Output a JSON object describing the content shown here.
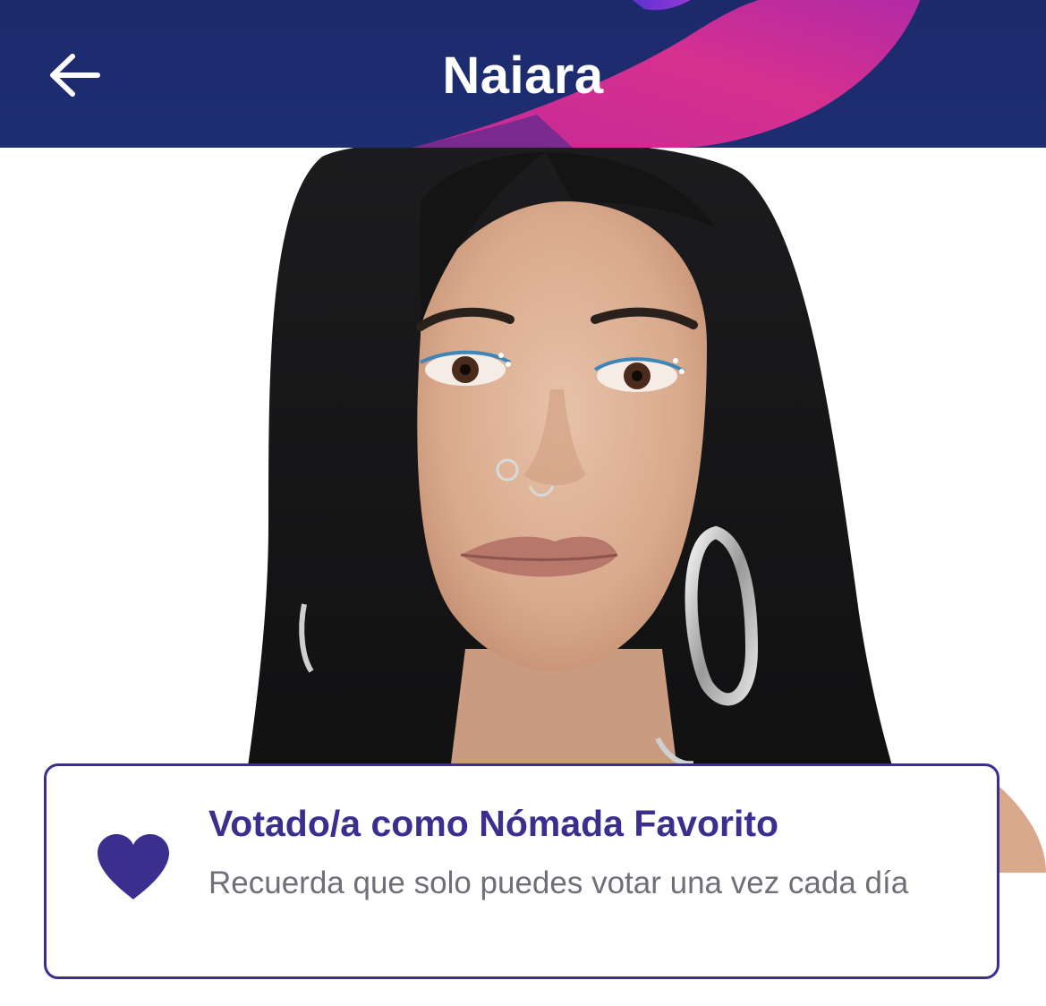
{
  "header": {
    "title": "Naiara",
    "back_icon": "arrow-left-icon",
    "colors": {
      "background": "#1c2a6b",
      "accent_magenta": "#d6308f",
      "accent_purple": "#7b2fd0"
    }
  },
  "vote_card": {
    "icon": "heart-icon",
    "title": "Votado/a como Nómada Favorito",
    "subtitle": "Recuerda que solo puedes votar una vez cada día",
    "colors": {
      "border": "#3a2f8f",
      "title": "#3a2f8f",
      "heart": "#3a2f8f",
      "subtitle": "#6f6f78"
    }
  }
}
